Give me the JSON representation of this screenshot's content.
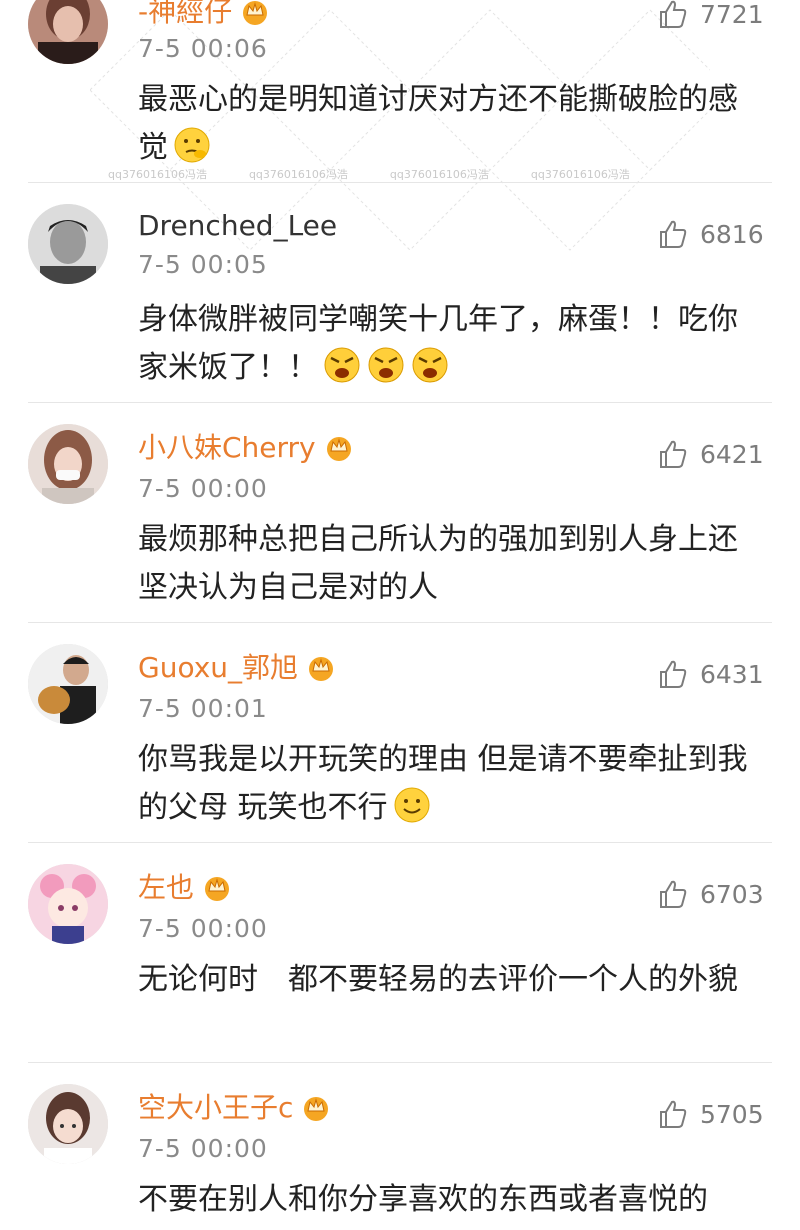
{
  "comments": [
    {
      "username": "-神經仔",
      "time": "7-5 00:06",
      "likes": "7721",
      "text": "最恶心的是明知道讨厌对方还不能撕破脸的感觉",
      "vip": true,
      "emoji": [
        "thinking-emoji"
      ],
      "avatar": "avatar-1"
    },
    {
      "username": "Drenched_Lee",
      "time": "7-5 00:05",
      "likes": "6816",
      "text": "身体微胖被同学嘲笑十几年了，麻蛋！！吃你家米饭了！！",
      "vip": false,
      "emoji": [
        "angry-emoji",
        "angry-emoji",
        "angry-emoji"
      ],
      "avatar": "avatar-2"
    },
    {
      "username": "小八妹Cherry",
      "time": "7-5 00:00",
      "likes": "6421",
      "text": "最烦那种总把自己所认为的强加到别人身上还坚决认为自己是对的人",
      "vip": true,
      "emoji": [],
      "avatar": "avatar-3"
    },
    {
      "username": "Guoxu_郭旭",
      "time": "7-5 00:01",
      "likes": "6431",
      "text": "你骂我是以开玩笑的理由 但是请不要牵扯到我的父母 玩笑也不行",
      "vip": true,
      "emoji": [
        "smile-emoji"
      ],
      "avatar": "avatar-4"
    },
    {
      "username": "左也",
      "time": "7-5 00:00",
      "likes": "6703",
      "text": "无论何时　都不要轻易的去评价一个人的外貌",
      "vip": true,
      "emoji": [],
      "avatar": "avatar-5"
    },
    {
      "username": "空大小王子c",
      "time": "7-5 00:00",
      "likes": "5705",
      "text": "不要在别人和你分享喜欢的东西或者喜悦的",
      "vip": true,
      "emoji": [],
      "avatar": "avatar-6"
    }
  ],
  "watermark": "qq376016106冯浩",
  "colors": {
    "vip_name": "#e87d2f",
    "time": "#8a8a8a",
    "divider": "#e6e6e6"
  }
}
